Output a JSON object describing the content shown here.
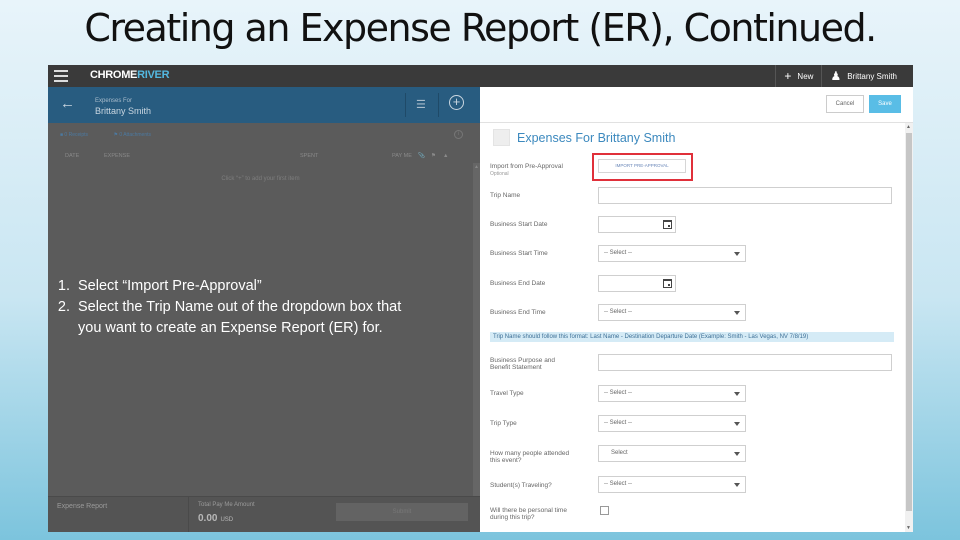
{
  "slide": {
    "title": "Creating an Expense Report (ER), Continued.",
    "instructions": [
      "Select “Import Pre-Approval”",
      "Select the Trip Name out of the dropdown box that you want to create an Expense Report (ER) for."
    ]
  },
  "topbar": {
    "logo_part1": "CHROME",
    "logo_part2": "RIVER",
    "new_label": "New",
    "user_name": "Brittany Smith",
    "icons": [
      "menu-icon",
      "plus-icon",
      "user-icon"
    ]
  },
  "left_panel": {
    "header": {
      "subtitle": "Expenses For",
      "name": "Brittany Smith"
    },
    "filters": {
      "receipts": "0 Receipts",
      "attachments": "0 Attachments"
    },
    "columns": {
      "date": "DATE",
      "expense": "EXPENSE",
      "spent": "SPENT",
      "pay_me": "PAY ME"
    },
    "empty_hint": "Click “+” to add your first item",
    "footer": {
      "report_label": "Expense Report",
      "total_label": "Total Pay Me Amount",
      "total_value": "0.00",
      "currency": "USD",
      "submit_label": "Submit"
    }
  },
  "right_panel": {
    "cancel_label": "Cancel",
    "save_label": "Save",
    "title": "Expenses For Brittany Smith",
    "import": {
      "label": "Import from Pre-Approval",
      "optional": "Optional",
      "button": "IMPORT PRE-APPROVAL"
    },
    "fields": {
      "trip_name": "Trip Name",
      "business_start_date": "Business Start Date",
      "business_start_time": "Business Start Time",
      "business_end_date": "Business End Date",
      "business_end_time": "Business End Time",
      "purpose": "Business Purpose and Benefit Statement",
      "travel_type": "Travel Type",
      "trip_type": "Trip Type",
      "attendees": "How many people attended this event?",
      "students": "Student(s) Traveling?",
      "personal_time": "Will there be personal time during this trip?"
    },
    "select_placeholder": "-- Select --",
    "select_short": "Select",
    "trip_name_note": "Trip Name should follow this format: Last Name - Destination Departure Date (Example: Smith - Las Vegas, NV 7/8/19)"
  }
}
